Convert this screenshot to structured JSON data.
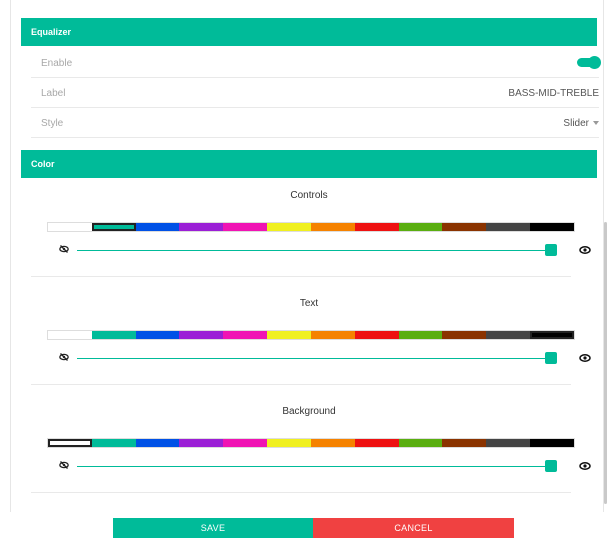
{
  "equalizer": {
    "header": "Equalizer",
    "enable_label": "Enable",
    "enable_on": true,
    "label_label": "Label",
    "label_value": "BASS-MID-TREBLE",
    "style_label": "Style",
    "style_value": "Slider"
  },
  "color": {
    "header": "Color",
    "palette": [
      "#ffffff",
      "#00bb99",
      "#0051e6",
      "#9b1fd6",
      "#f014b4",
      "#f0f020",
      "#f58200",
      "#ee1111",
      "#5aae10",
      "#8a3300",
      "#444444",
      "#000000"
    ],
    "subsections": [
      {
        "title": "Controls",
        "selected_index": 1,
        "opacity": 1.0
      },
      {
        "title": "Text",
        "selected_index": 11,
        "opacity": 1.0
      },
      {
        "title": "Background",
        "selected_index": 0,
        "opacity": 1.0
      }
    ]
  },
  "actions": {
    "save_label": "SAVE",
    "cancel_label": "CANCEL"
  },
  "colors": {
    "accent": "#00bb99",
    "danger": "#f04141"
  },
  "icons": {
    "hidden": "eye-off-icon",
    "visible": "eye-icon"
  }
}
